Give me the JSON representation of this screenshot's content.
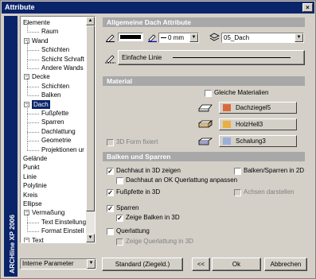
{
  "window": {
    "title": "Attribute",
    "close_glyph": "×"
  },
  "sidebar": {
    "product": "ARCHline XP 2006"
  },
  "tree": {
    "items": [
      {
        "label": "Elemente",
        "level": 0
      },
      {
        "label": "Raum",
        "level": 1
      },
      {
        "label": "Wand",
        "level": 0,
        "expanded": true
      },
      {
        "label": "Schichten",
        "level": 1
      },
      {
        "label": "Schicht Schraft",
        "level": 1
      },
      {
        "label": "Andere Wands",
        "level": 1
      },
      {
        "label": "Decke",
        "level": 0,
        "expanded": true
      },
      {
        "label": "Schichten",
        "level": 1
      },
      {
        "label": "Balken",
        "level": 1
      },
      {
        "label": "Dach",
        "level": 0,
        "expanded": true,
        "selected": true
      },
      {
        "label": "Fußpfette",
        "level": 1
      },
      {
        "label": "Sparren",
        "level": 1
      },
      {
        "label": "Dachlattung",
        "level": 1
      },
      {
        "label": "Geometrie",
        "level": 1
      },
      {
        "label": "Projektionen ur",
        "level": 1
      },
      {
        "label": "Gelände",
        "level": 0
      },
      {
        "label": "Punkt",
        "level": 0
      },
      {
        "label": "Linie",
        "level": 0
      },
      {
        "label": "Polylinie",
        "level": 0
      },
      {
        "label": "Kreis",
        "level": 0
      },
      {
        "label": "Ellipse",
        "level": 0
      },
      {
        "label": "Vermaßung",
        "level": 0,
        "expanded": true
      },
      {
        "label": "Text Einstellung",
        "level": 1
      },
      {
        "label": "Format Einstell",
        "level": 1
      },
      {
        "label": "Text",
        "level": 0,
        "expanded": true
      }
    ]
  },
  "general": {
    "header": "Allgemeine Dach Attribute",
    "line_width": "0 mm",
    "layer": "05_Dach",
    "line_style_label": "Einfache Linie"
  },
  "material": {
    "header": "Material",
    "same_materials_label": "Gleiche Materialien",
    "same_materials_checked": false,
    "form_3d_label": "3D Form fixiert",
    "form_3d_checked": false,
    "materials": [
      {
        "name": "Dachziegel5",
        "color": "#d86a3a"
      },
      {
        "name": "HolzHell3",
        "color": "#e8b040"
      },
      {
        "name": "Schalung3",
        "color": "#9ab0d8"
      }
    ]
  },
  "beams": {
    "header": "Balken und Sparren",
    "options": [
      {
        "label": "Dachhaut in 3D zeigen",
        "checked": true,
        "disabled": false
      },
      {
        "label": "Dachhaut an OK Querlattung anpassen",
        "checked": false,
        "disabled": false
      },
      {
        "label": "Fußpfette in 3D",
        "checked": true,
        "disabled": false
      },
      {
        "label": "Sparren",
        "checked": true,
        "disabled": false
      },
      {
        "label": "Zeige Balken in 3D",
        "checked": true,
        "disabled": false
      },
      {
        "label": "Querlattung",
        "checked": false,
        "disabled": false
      },
      {
        "label": "Zeige Querlattung in 3D",
        "checked": false,
        "disabled": true
      }
    ],
    "right_options": [
      {
        "label": "Balken/Sparren in 2D",
        "checked": false,
        "disabled": false
      },
      {
        "label": "Achsen darstellen",
        "checked": false,
        "disabled": true
      }
    ]
  },
  "footer": {
    "params_select": "Interne Parameter",
    "standard_button": "Standard (Ziegeld.)",
    "back_button": "<<",
    "ok_button": "Ok",
    "cancel_button": "Abbrechen"
  },
  "colors": {
    "title_bar": "#0a246a",
    "section_header": "#a8a8a8",
    "face": "#d4d0c8"
  }
}
